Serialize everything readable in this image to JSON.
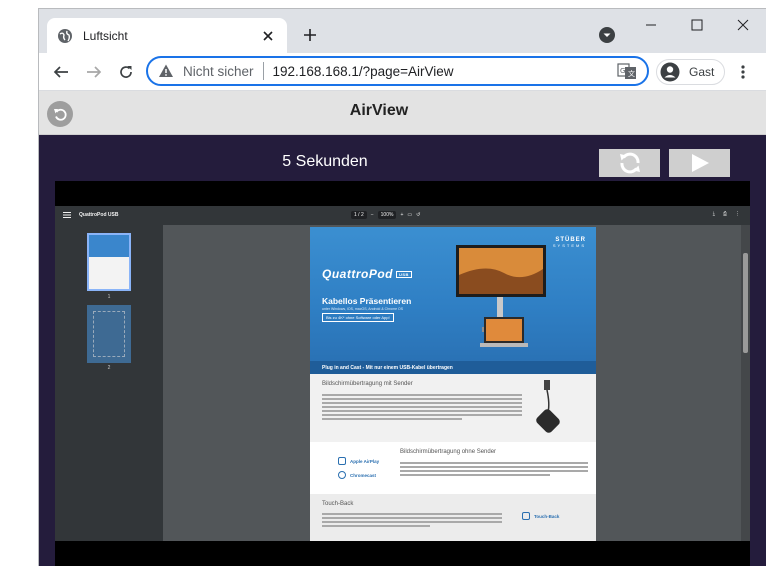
{
  "browser": {
    "tab_title": "Luftsicht",
    "security_label": "Nicht sicher",
    "url": "192.168.168.1/?page=AirView",
    "profile_label": "Gast"
  },
  "page": {
    "title": "AirView",
    "countdown": "5 Sekunden"
  },
  "pdf": {
    "filename": "QuattroPod USB",
    "page_indicator": "1 / 2",
    "zoom": "100%",
    "thumbnails": [
      {
        "label": "1"
      },
      {
        "label": "2"
      }
    ]
  },
  "document": {
    "brand": "STÜBER",
    "brand_sub": "SYSTEMS",
    "product": "QuattroPod",
    "product_tag": "USB",
    "headline": "Kabellos Präsentieren",
    "subline": "unter Windows, iOS, macOS, Android & Chrome OS",
    "badge": "Bis zu 4K* ohne Software oder App!",
    "plug_banner": "Plug in and Cast - Mit nur einem USB-Kabel übertragen",
    "section1_title": "Bildschirmübertragung mit Sender",
    "section2_title": "Bildschirmübertragung ohne Sender",
    "section2_link1": "Apple AirPlay",
    "section2_link2": "Chromecast",
    "section3_title": "Touch-Back",
    "section3_link": "Touch-Back"
  },
  "colors": {
    "content_bg": "#241c3c",
    "accent_blue": "#1a73e8",
    "doc_blue": "#2f7fc4"
  }
}
